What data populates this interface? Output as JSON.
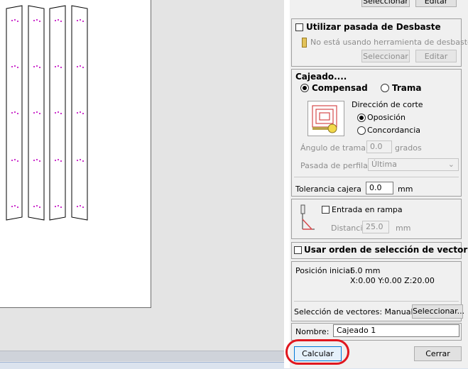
{
  "top_buttons": {
    "select": "Seleccionar",
    "edit": "Editar"
  },
  "roughing": {
    "title": "Utilizar pasada de Desbaste",
    "status": "No está usando herramienta de desbaste",
    "select": "Seleccionar",
    "edit": "Editar"
  },
  "pocket": {
    "title": "Cajeado....",
    "option_compensated": "Compensad",
    "option_raster": "Trama",
    "cut_direction_label": "Dirección de corte",
    "opt_conventional": "Oposición",
    "opt_climb": "Concordancia",
    "raster_angle_label": "Ángulo de trama",
    "raster_angle_value": "0.0",
    "raster_angle_unit": "grados",
    "profile_pass_label": "Pasada de perfilado",
    "profile_pass_value": "Última",
    "tolerance_label": "Tolerancia cajera",
    "tolerance_value": "0.0",
    "tolerance_unit": "mm"
  },
  "ramp": {
    "title": "Entrada en rampa",
    "distance_label": "Distancia",
    "distance_value": "25.0",
    "distance_unit": "mm"
  },
  "vector_order": {
    "title": "Usar orden de selección de vectores"
  },
  "start_position": {
    "label": "Posición inicial",
    "value": "6.0 mm",
    "coords": "X:0.00 Y:0.00 Z:20.00"
  },
  "vector_selection": {
    "label": "Selección de vectores:",
    "mode": "Manual",
    "select": "Seleccionar..."
  },
  "name": {
    "label": "Nombre:",
    "value": "Cajeado 1"
  },
  "actions": {
    "calculate": "Calcular",
    "close": "Cerrar"
  },
  "colors": {
    "highlight": "#e0171f",
    "marker": "#cc33cc"
  }
}
